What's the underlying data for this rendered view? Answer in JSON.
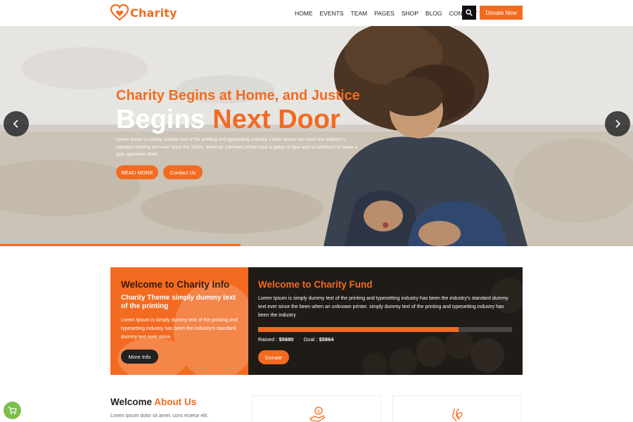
{
  "brand": {
    "name": "Charity",
    "accent": "#f26b21"
  },
  "nav": {
    "items": [
      "HOME",
      "EVENTS",
      "TEAM",
      "PAGES",
      "SHOP",
      "BLOG",
      "CONTACT US"
    ],
    "donate_label": "Donate Now",
    "search_icon": "search-icon"
  },
  "hero": {
    "subtitle": "Charity Begins at Home, and Justice",
    "title_white": "Begins",
    "title_accent": "Next Door",
    "text": "Lorem Ipsum is simply dummy text of the printing and typesetting industry. Lorem Ipsum has been the industry's standard dummy text ever since the 1500s, when an unknown printer took a galley of type and scrambled it to make a type specimen book.",
    "read_more": "READ MORE",
    "contact": "Contact Us",
    "slide_progress": 0.38
  },
  "info": {
    "title": "Welcome to Charity Info",
    "subtitle": "Charity Theme simply dummy text of the printing",
    "text": "Lorem Ipsum is simply dummy text of the printing and typesetting industry has been the industry's standard dummy text ever since.",
    "button": "More Info"
  },
  "fund": {
    "title": "Welcome to Charity Fund",
    "text": "Lorem Ipsum is simply dummy text of the printing and typesetting industry has been the industry's standard dummy text ever since the been when an unknown printer. simply dummy text of the printing and typesetting industry has been the industry",
    "raised_label": "Raised :",
    "raised_value": "$5680",
    "goal_label": "Goal :",
    "goal_value": "$5864",
    "progress": 0.79,
    "button": "Donate"
  },
  "about": {
    "title_plain": "Welcome",
    "title_accent": "About Us",
    "text": "Lorem ipsum dolor sit amet, cons ectetur elit."
  }
}
